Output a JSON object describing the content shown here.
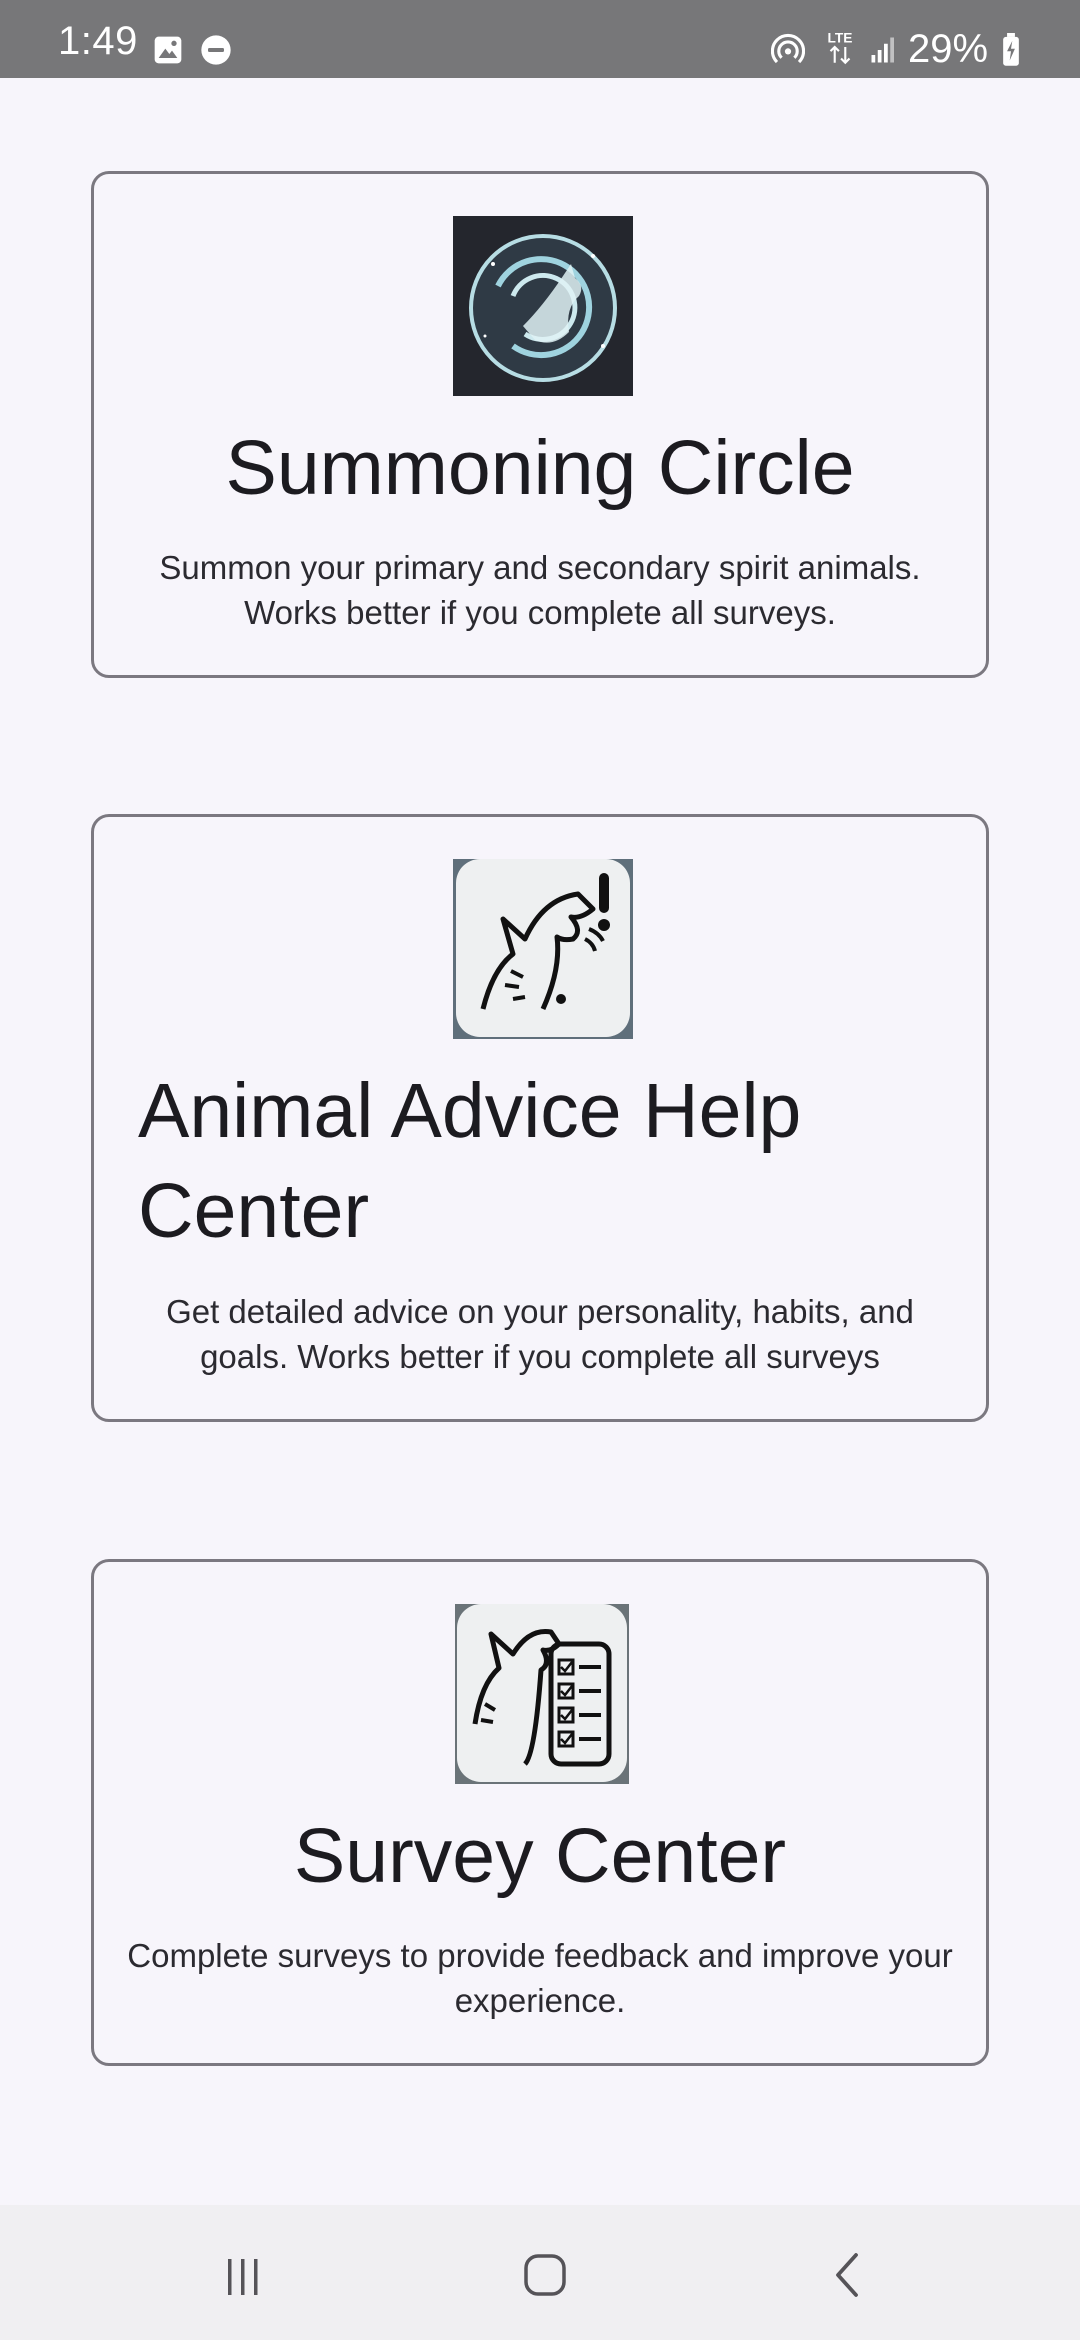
{
  "status_bar": {
    "time": "1:49",
    "battery": "29%",
    "network": "LTE",
    "icons": [
      "image-icon",
      "do-not-disturb-icon",
      "hotspot-icon",
      "lte-icon",
      "signal-icon",
      "battery-charging-icon"
    ]
  },
  "cards": [
    {
      "title": "Summoning Circle",
      "description": "Summon your primary and secondary spirit animals. Works better if you complete all surveys.",
      "image": "spirit-wolf-circle-image"
    },
    {
      "title": "Animal Advice Help Center",
      "description": "Get detailed advice on your personality, habits, and goals. Works better if you complete all surveys",
      "image": "howling-wolf-alert-image"
    },
    {
      "title": "Survey Center",
      "description": "Complete surveys to provide feedback and improve your experience.",
      "image": "wolf-checklist-image"
    }
  ],
  "nav_bar": {
    "buttons": [
      "recents-icon",
      "home-icon",
      "back-icon"
    ]
  },
  "colors": {
    "background": "#f7f5fb",
    "status_bar": "#777779",
    "card_border": "#7b7880",
    "text": "#1c1b20",
    "nav_bar": "#f0eff2"
  }
}
